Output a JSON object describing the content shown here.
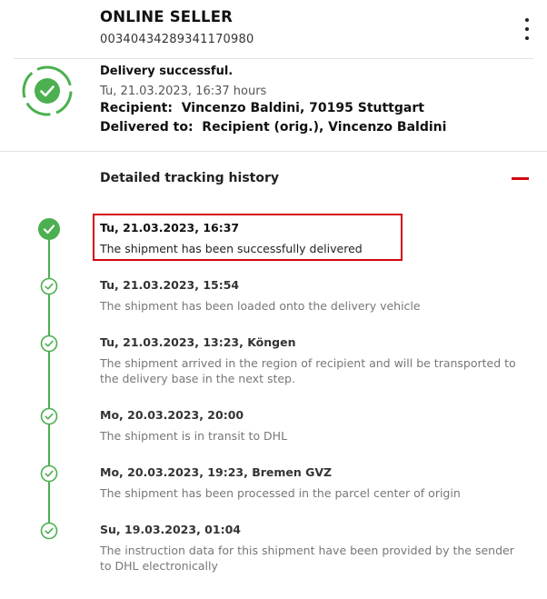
{
  "header": {
    "seller": "ONLINE SELLER",
    "tracking_number": "00340434289341170980"
  },
  "summary": {
    "status": "Delivery successful.",
    "time": "Tu, 21.03.2023, 16:37 hours",
    "recipient_label": "Recipient:",
    "recipient_value": "Vincenzo Baldini, 70195 Stuttgart",
    "delivered_label": "Delivered to:",
    "delivered_value": "Recipient (orig.), Vincenzo Baldini",
    "icon": "check-circle-icon",
    "accent_color": "#4caf50"
  },
  "history": {
    "title": "Detailed tracking history",
    "collapse_icon": "minus-icon",
    "collapse_color": "#d40511",
    "events": [
      {
        "time": "Tu, 21.03.2023, 16:37",
        "description": "The shipment has been successfully delivered"
      },
      {
        "time": "Tu, 21.03.2023, 15:54",
        "description": "The shipment has been loaded onto the delivery vehicle"
      },
      {
        "time": "Tu, 21.03.2023, 13:23, Köngen",
        "description": "The shipment arrived in the region of recipient and will be transported to the delivery base in the next step."
      },
      {
        "time": "Mo, 20.03.2023, 20:00",
        "description": "The shipment is in transit to DHL"
      },
      {
        "time": "Mo, 20.03.2023, 19:23, Bremen GVZ",
        "description": "The shipment has been processed in the parcel center of origin"
      },
      {
        "time": "Su, 19.03.2023, 01:04",
        "description": "The instruction data for this shipment have been provided by the sender to DHL electronically"
      }
    ]
  }
}
